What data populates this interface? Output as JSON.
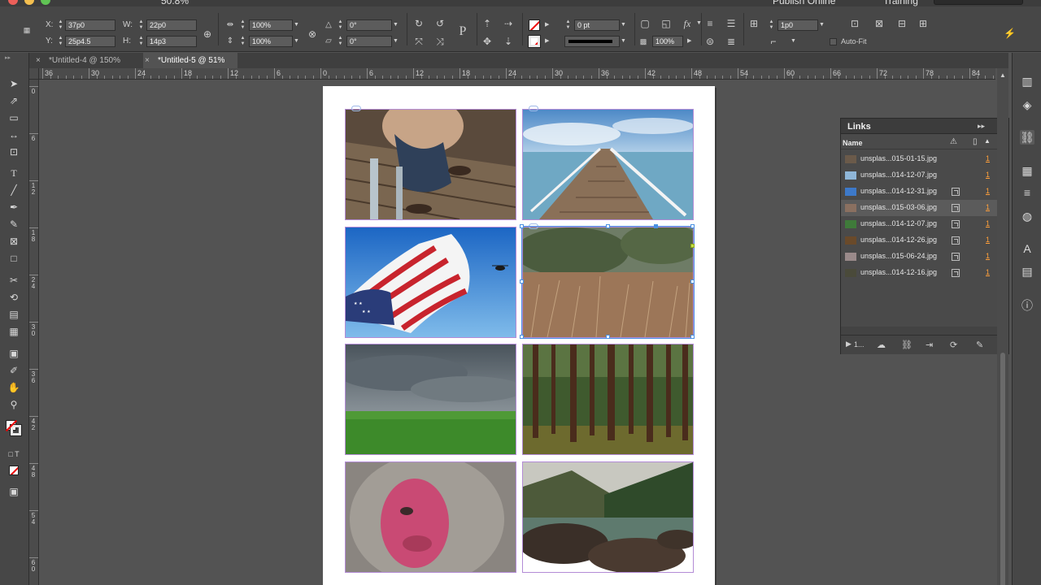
{
  "appbar": {
    "zoom": "50.8%",
    "publish_online": "Publish Online",
    "workspace": "Training"
  },
  "control": {
    "x_label": "X:",
    "x_value": "37p0",
    "y_label": "Y:",
    "y_value": "25p4.5",
    "w_label": "W:",
    "w_value": "22p0",
    "h_label": "H:",
    "h_value": "14p3",
    "scale_x": "100%",
    "scale_y": "100%",
    "rotate": "0°",
    "shear": "0°",
    "stroke_weight": "0 pt",
    "corner": "1p0",
    "opacity": "100%",
    "autofit_label": "Auto-Fit"
  },
  "tabs": [
    {
      "label": "*Untitled-4 @ 150%",
      "close": "×"
    },
    {
      "label": "*Untitled-5 @ 51%",
      "close": "×"
    }
  ],
  "ruler": {
    "h_labels": [
      "36",
      "30",
      "24",
      "18",
      "12",
      "6",
      "0",
      "6",
      "12",
      "18",
      "24",
      "30",
      "36",
      "42",
      "48",
      "54",
      "60",
      "66",
      "72",
      "78",
      "84"
    ],
    "v_labels": [
      "0",
      "6",
      "1 2",
      "1 8",
      "2 4",
      "3 0",
      "3 6",
      "4 2",
      "4 8",
      "5 4",
      "6 0"
    ]
  },
  "links_panel": {
    "title": "Links",
    "column_name": "Name",
    "footer_count": "1...",
    "items": [
      {
        "name": "unsplas...015-01-15.jpg",
        "page": "1",
        "embedded": false,
        "selected": false,
        "thumb": "#6b5a4a"
      },
      {
        "name": "unsplas...014-12-07.jpg",
        "page": "1",
        "embedded": false,
        "selected": false,
        "thumb": "#8fb6d8"
      },
      {
        "name": "unsplas...014-12-31.jpg",
        "page": "1",
        "embedded": true,
        "selected": false,
        "thumb": "#3d79c9"
      },
      {
        "name": "unsplas...015-03-06.jpg",
        "page": "1",
        "embedded": true,
        "selected": true,
        "thumb": "#8a7060"
      },
      {
        "name": "unsplas...014-12-07.jpg",
        "page": "1",
        "embedded": true,
        "selected": false,
        "thumb": "#3f7a3a"
      },
      {
        "name": "unsplas...014-12-26.jpg",
        "page": "1",
        "embedded": true,
        "selected": false,
        "thumb": "#6a4a2a"
      },
      {
        "name": "unsplas...015-06-24.jpg",
        "page": "1",
        "embedded": true,
        "selected": false,
        "thumb": "#9a8a8a"
      },
      {
        "name": "unsplas...014-12-16.jpg",
        "page": "1",
        "embedded": true,
        "selected": false,
        "thumb": "#4a4a3a"
      }
    ]
  },
  "colors": {
    "frame_outline": "#b38bd6",
    "selection": "#4a90e2",
    "page_link": "#ff9f3a"
  }
}
